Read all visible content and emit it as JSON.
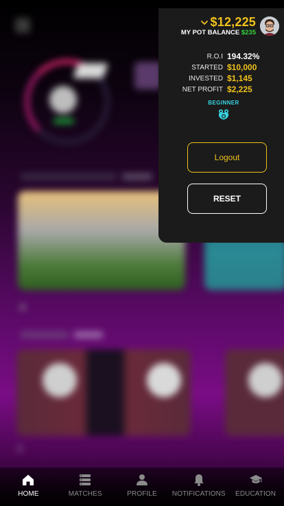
{
  "header": {
    "balance": "$12,225",
    "pot_balance_label": "MY POT BALANCE",
    "pot_balance_value": "$235"
  },
  "stats": [
    {
      "label": "R.O.I",
      "value": "194.32%"
    },
    {
      "label": "STARTED",
      "value": "$10,000"
    },
    {
      "label": "INVESTED",
      "value": "$1,145"
    },
    {
      "label": "NET PROFIT",
      "value": "$2,225"
    }
  ],
  "level": {
    "label": "BEGINNER",
    "icon": "frog-icon"
  },
  "buttons": {
    "logout": "Logout",
    "reset": "RESET"
  },
  "nav": [
    {
      "label": "HOME",
      "icon": "home-icon",
      "active": true
    },
    {
      "label": "MATCHES",
      "icon": "matches-icon",
      "active": false
    },
    {
      "label": "PROFILE",
      "icon": "profile-icon",
      "active": false
    },
    {
      "label": "NOTIFICATIONS",
      "icon": "bell-icon",
      "active": false
    },
    {
      "label": "EDUCATION",
      "icon": "graduation-cap-icon",
      "active": false
    }
  ],
  "colors": {
    "accent": "#f1c21b",
    "positive": "#34d43c",
    "level": "#37d4e0",
    "panel": "#1b1b1b"
  }
}
